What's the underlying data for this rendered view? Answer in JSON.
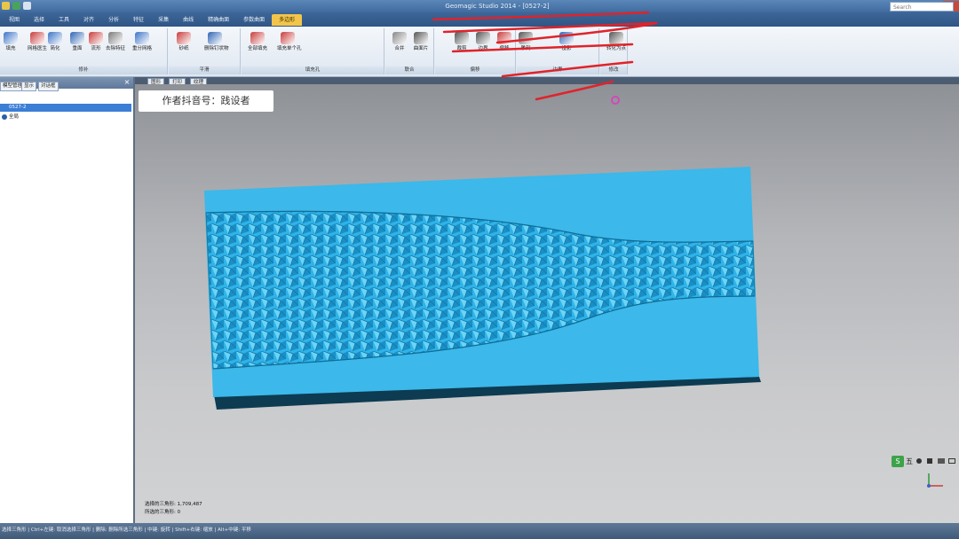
{
  "window": {
    "title": "Geomagic Studio 2014 - [0527-2]"
  },
  "search": {
    "placeholder": "Search"
  },
  "tabs": [
    {
      "label": "视图",
      "active": false
    },
    {
      "label": "选择",
      "active": false
    },
    {
      "label": "工具",
      "active": false
    },
    {
      "label": "对齐",
      "active": false
    },
    {
      "label": "分析",
      "active": false
    },
    {
      "label": "特征",
      "active": false
    },
    {
      "label": "采集",
      "active": false
    },
    {
      "label": "曲线",
      "active": false
    },
    {
      "label": "精确曲面",
      "active": false
    },
    {
      "label": "参数曲面",
      "active": false
    },
    {
      "label": "多边形",
      "active": true
    }
  ],
  "ribbon": {
    "buttons": [
      {
        "label": "填充",
        "icon": "fill-icon",
        "color": "#3b74c8"
      },
      {
        "label": "网格医生",
        "icon": "mesh-doctor-icon",
        "color": "#c93b3b"
      },
      {
        "label": "简化",
        "icon": "simplify-icon",
        "color": "#3b74c8"
      },
      {
        "label": "重面",
        "icon": "remesh-icon",
        "color": "#2d64b5"
      },
      {
        "label": "流形",
        "icon": "manifold-icon",
        "color": "#c93b3b"
      },
      {
        "label": "去除特征",
        "icon": "remove-feature-icon",
        "color": "#7a7a7a"
      },
      {
        "label": "重分网格",
        "icon": "regrid-icon",
        "color": "#3b74c8"
      },
      {
        "label": "砂纸",
        "icon": "sandpaper-icon",
        "color": "#c93b3b"
      },
      {
        "label": "删除钉状物",
        "icon": "delete-spikes-icon",
        "color": "#2d64b5"
      },
      {
        "label": "全部填充",
        "icon": "fill-all-icon",
        "color": "#c93b3b"
      },
      {
        "label": "填充单个孔",
        "icon": "fill-single-icon",
        "color": "#c93b3b"
      },
      {
        "label": "合并",
        "icon": "merge-icon",
        "color": "#888"
      },
      {
        "label": "曲面片",
        "icon": "patch-icon",
        "color": "#555"
      },
      {
        "label": "裁剪",
        "icon": "trim-icon",
        "color": "#555"
      },
      {
        "label": "边界",
        "icon": "boundary-icon",
        "color": "#555"
      },
      {
        "label": "偏移",
        "icon": "offset-icon",
        "color": "#c93b3b"
      },
      {
        "label": "雕刻",
        "icon": "sculpt-icon",
        "color": "#555"
      },
      {
        "label": "投影",
        "icon": "project-icon",
        "color": "#2d64b5"
      },
      {
        "label": "转化为点",
        "icon": "convert-points-icon",
        "color": "#555"
      }
    ],
    "groups": [
      {
        "label": "修补"
      },
      {
        "label": "平滑"
      },
      {
        "label": "填充孔"
      },
      {
        "label": "联合"
      },
      {
        "label": "偏移"
      },
      {
        "label": "边界"
      },
      {
        "label": "修改"
      }
    ]
  },
  "left_panel": {
    "tabs": [
      {
        "label": "模型管理器"
      },
      {
        "label": "显示"
      },
      {
        "label": "对话框"
      }
    ],
    "tree": [
      {
        "label": "0527-2",
        "selected": true
      },
      {
        "label": "全局",
        "selected": false
      }
    ]
  },
  "viewport": {
    "tabs": [
      {
        "label": "图形"
      },
      {
        "label": "打印"
      },
      {
        "label": "纹理"
      }
    ],
    "watermark": "作者抖音号：践设者",
    "stats": {
      "total_triangles": "选择的三角形: 1,709,487",
      "selected_triangles": "所选的三角形: 0"
    },
    "model_color": "#2ab4e6"
  },
  "nav": {
    "logo_text": "五"
  },
  "status": {
    "text": "选择三角形 | Ctrl+左键: 取消选择三角形 | 删除: 删除所选三角形 | 中键: 旋转 | Shift+右键: 缩放 | Alt+中键: 平移"
  }
}
